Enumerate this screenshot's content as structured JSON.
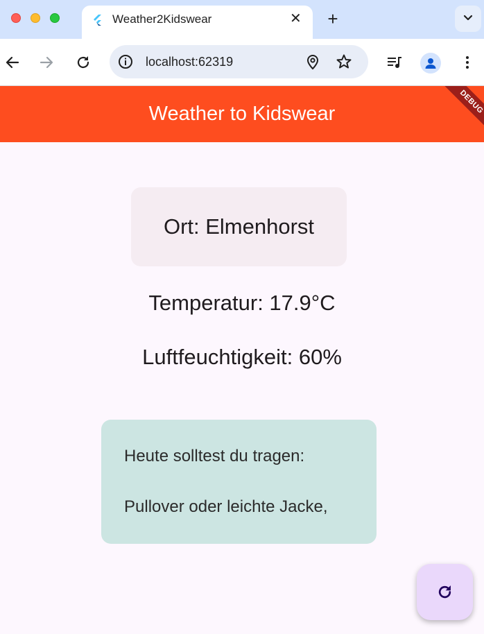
{
  "browser": {
    "tab_title": "Weather2Kidswear",
    "url": "localhost:62319"
  },
  "app": {
    "title": "Weather to Kidswear",
    "debug_label": "DEBUG",
    "location": "Ort: Elmenhorst",
    "temperature": "Temperatur: 17.9°C",
    "humidity": "Luftfeuchtigkeit: 60%",
    "advice_heading": "Heute solltest du tragen:",
    "advice_items": [
      "Pullover oder leichte Jacke,"
    ]
  },
  "colors": {
    "appbar": "#fe4d1f",
    "location_card": "#f5ecf2",
    "advice_card": "#cce5e2",
    "fab": "#ead8fb",
    "background": "#fdf7fe"
  },
  "icons": {
    "refresh_fab": "refresh-icon",
    "tab_favicon": "flutter-icon"
  }
}
